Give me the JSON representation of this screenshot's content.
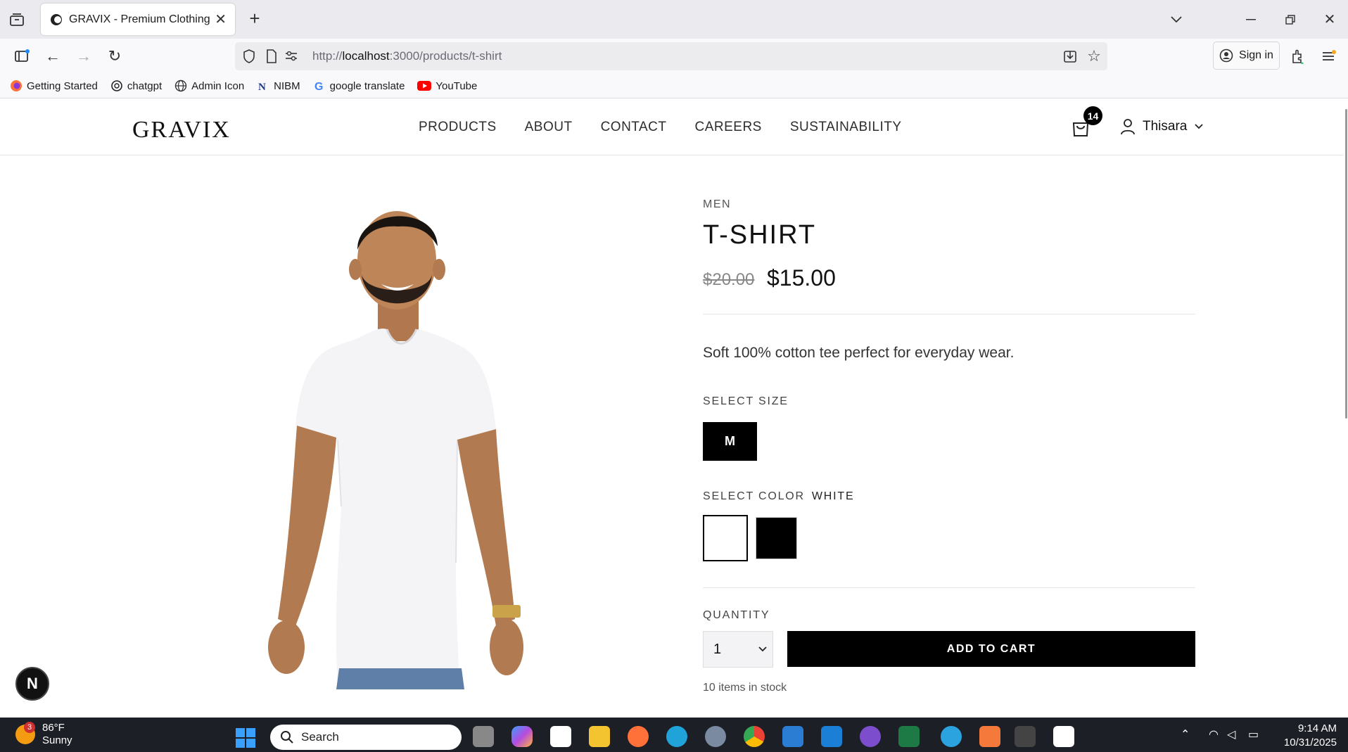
{
  "browser": {
    "tab_title": "GRAVIX - Premium Clothing Sto",
    "url_prefix": "http://",
    "url_host": "localhost",
    "url_path": ":3000/products/t-shirt",
    "sign_in": "Sign in",
    "bookmarks": [
      {
        "label": "Getting Started",
        "icon": "firefox-icon"
      },
      {
        "label": "chatgpt",
        "icon": "chatgpt-icon"
      },
      {
        "label": "Admin Icon",
        "icon": "globe-icon"
      },
      {
        "label": "NIBM",
        "icon": "nibm-icon"
      },
      {
        "label": "google translate",
        "icon": "google-icon"
      },
      {
        "label": "YouTube",
        "icon": "youtube-icon"
      }
    ]
  },
  "site": {
    "logo": "GRAVIX",
    "nav": [
      "PRODUCTS",
      "ABOUT",
      "CONTACT",
      "CAREERS",
      "SUSTAINABILITY"
    ],
    "cart_count": "14",
    "user_name": "Thisara"
  },
  "product": {
    "category": "MEN",
    "title": "T-SHIRT",
    "old_price": "$20.00",
    "price": "$15.00",
    "description": "Soft 100% cotton tee perfect for everyday wear.",
    "size_label": "SELECT SIZE",
    "sizes": [
      "M"
    ],
    "color_label": "SELECT COLOR",
    "selected_color": "WHITE",
    "colors": [
      "#ffffff",
      "#000000"
    ],
    "quantity_label": "QUANTITY",
    "quantity": "1",
    "add_to_cart": "ADD TO CART",
    "stock": "10 items in stock"
  },
  "dev_badge": "N",
  "taskbar": {
    "temperature": "86°F",
    "condition": "Sunny",
    "weather_badge": "3",
    "search_placeholder": "Search",
    "time": "9:14 AM",
    "date": "10/31/2025"
  }
}
